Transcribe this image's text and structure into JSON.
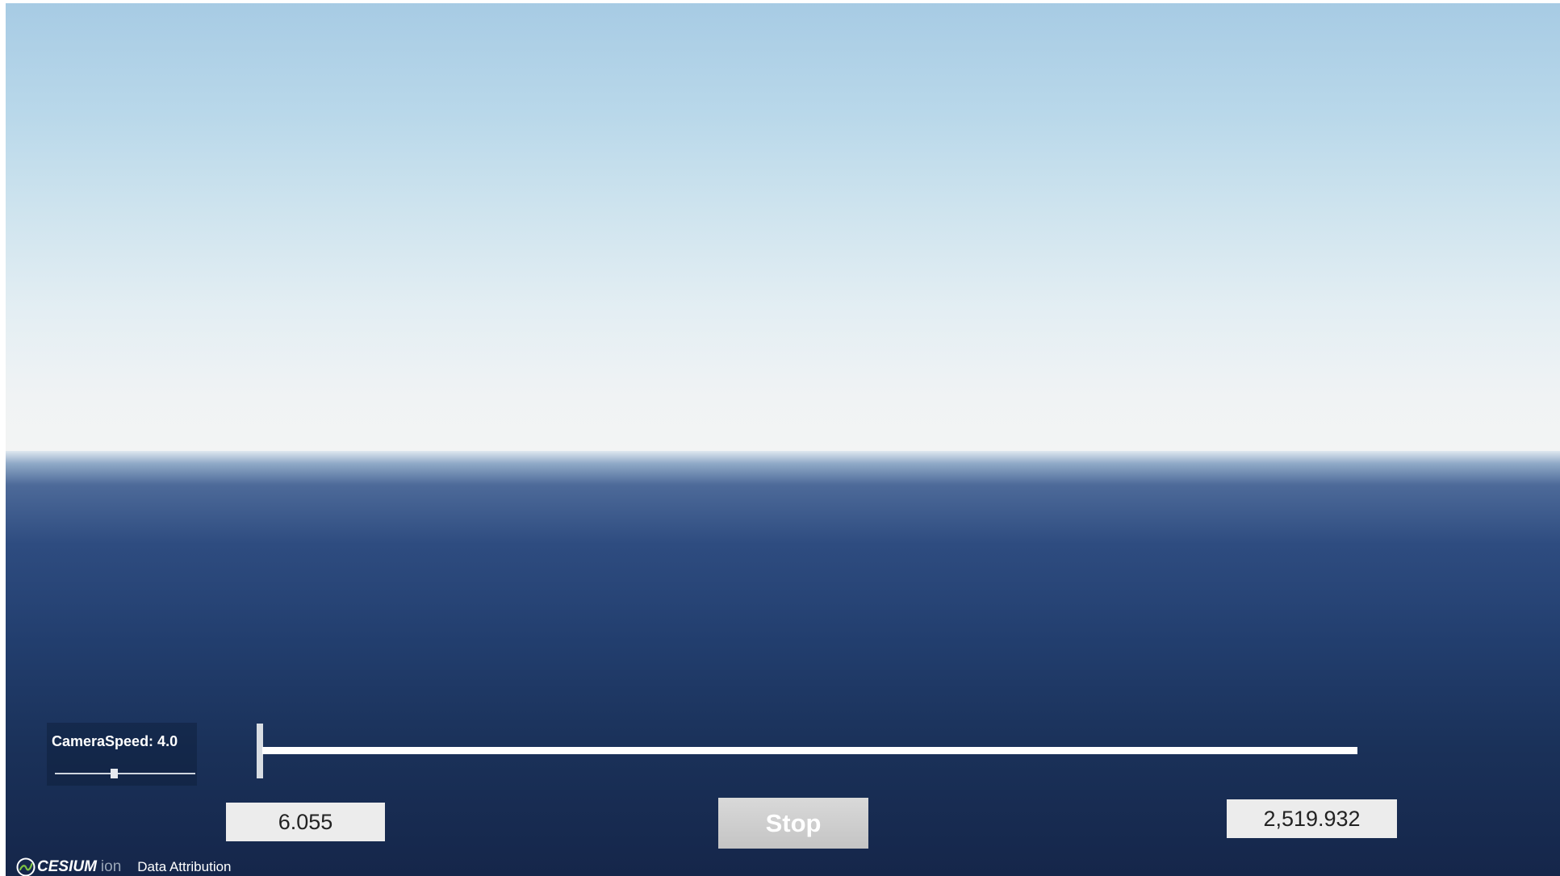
{
  "camera_speed": {
    "label": "CameraSpeed: 4.0",
    "slider_fraction": 0.42
  },
  "timeline": {
    "progress_fraction": 0.0,
    "start_value": "6.055",
    "end_value": "2,519.932"
  },
  "controls": {
    "stop_label": "Stop"
  },
  "footer": {
    "logo_text": "CESIUM",
    "logo_suffix": "ion",
    "attribution_label": "Data Attribution"
  },
  "colors": {
    "sky_top": "#a7cbe4",
    "horizon": "#f3f4f4",
    "ocean_deep": "#15264a",
    "button_gray": "#cfcfcf"
  },
  "icons": {
    "logo": "cesium-globe-icon"
  }
}
